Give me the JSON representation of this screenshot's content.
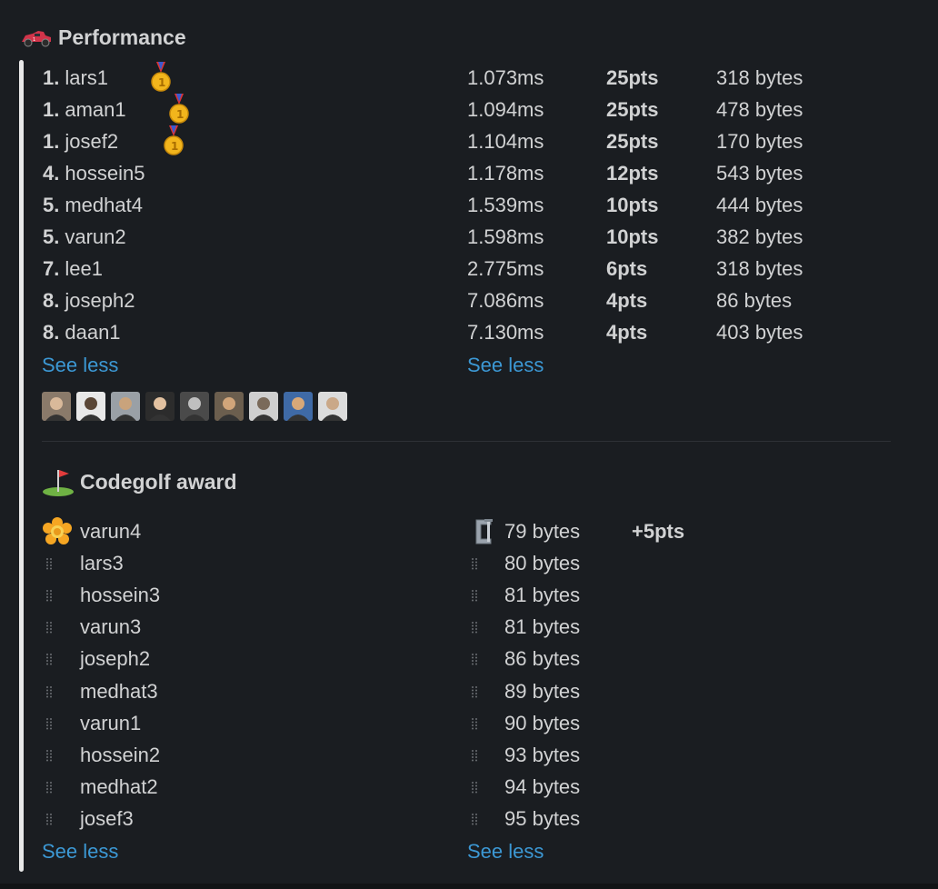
{
  "performance": {
    "title": "Performance",
    "icon": "race-car-icon",
    "rows": [
      {
        "rank": "1.",
        "name": "lars1",
        "medal": true,
        "time": "1.073ms",
        "pts": "25pts",
        "size": "318 bytes"
      },
      {
        "rank": "1.",
        "name": "aman1",
        "medal": true,
        "time": "1.094ms",
        "pts": "25pts",
        "size": "478 bytes"
      },
      {
        "rank": "1.",
        "name": "josef2",
        "medal": true,
        "time": "1.104ms",
        "pts": "25pts",
        "size": "170 bytes"
      },
      {
        "rank": "4.",
        "name": "hossein5",
        "medal": false,
        "time": "1.178ms",
        "pts": "12pts",
        "size": "543 bytes"
      },
      {
        "rank": "5.",
        "name": "medhat4",
        "medal": false,
        "time": "1.539ms",
        "pts": "10pts",
        "size": "444 bytes"
      },
      {
        "rank": "5.",
        "name": "varun2",
        "medal": false,
        "time": "1.598ms",
        "pts": "10pts",
        "size": "382 bytes"
      },
      {
        "rank": "7.",
        "name": "lee1",
        "medal": false,
        "time": "2.775ms",
        "pts": "6pts",
        "size": "318 bytes"
      },
      {
        "rank": "8.",
        "name": "joseph2",
        "medal": false,
        "time": "7.086ms",
        "pts": "4pts",
        "size": "86 bytes"
      },
      {
        "rank": "8.",
        "name": "daan1",
        "medal": false,
        "time": "7.130ms",
        "pts": "4pts",
        "size": "403 bytes"
      }
    ],
    "see_less_left": "See less",
    "see_less_right": "See less",
    "avatar_count": 9
  },
  "codegolf": {
    "title": "Codegolf award",
    "icon": "golf-flag-icon",
    "rows": [
      {
        "name": "varun4",
        "size": "79 bytes",
        "bonus": "+5pts",
        "winner": true
      },
      {
        "name": "lars3",
        "size": "80 bytes",
        "bonus": "",
        "winner": false
      },
      {
        "name": "hossein3",
        "size": "81 bytes",
        "bonus": "",
        "winner": false
      },
      {
        "name": "varun3",
        "size": "81 bytes",
        "bonus": "",
        "winner": false
      },
      {
        "name": "joseph2",
        "size": "86 bytes",
        "bonus": "",
        "winner": false
      },
      {
        "name": "medhat3",
        "size": "89 bytes",
        "bonus": "",
        "winner": false
      },
      {
        "name": "varun1",
        "size": "90 bytes",
        "bonus": "",
        "winner": false
      },
      {
        "name": "hossein2",
        "size": "93 bytes",
        "bonus": "",
        "winner": false
      },
      {
        "name": "medhat2",
        "size": "94 bytes",
        "bonus": "",
        "winner": false
      },
      {
        "name": "josef3",
        "size": "95 bytes",
        "bonus": "",
        "winner": false
      }
    ],
    "see_less_left": "See less",
    "see_less_right": "See less"
  },
  "colors": {
    "link": "#3c98d4",
    "text": "#d1d2d3",
    "background": "#1a1d21"
  }
}
